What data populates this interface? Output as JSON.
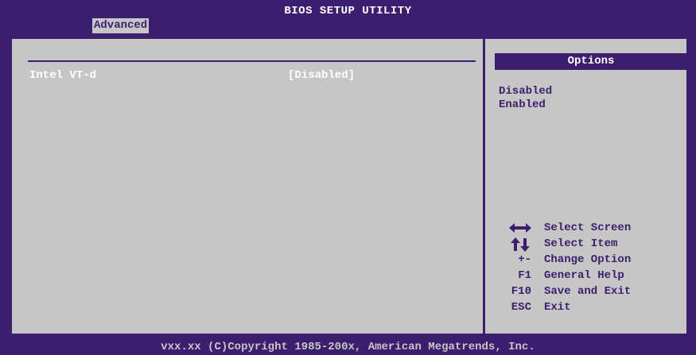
{
  "header": {
    "title": "BIOS SETUP UTILITY",
    "active_tab": "Advanced"
  },
  "settings": [
    {
      "label": "Intel VT-d",
      "value": "[Disabled]"
    }
  ],
  "options_panel": {
    "title": "Options",
    "items": [
      "Disabled",
      "Enabled"
    ]
  },
  "help": [
    {
      "key_icon": "left-right-arrows-icon",
      "key": "",
      "text": "Select Screen"
    },
    {
      "key_icon": "up-down-arrows-icon",
      "key": "",
      "text": "Select Item"
    },
    {
      "key": "+-",
      "text": "Change Option"
    },
    {
      "key": "F1",
      "text": "General Help"
    },
    {
      "key": "F10",
      "text": "Save and Exit"
    },
    {
      "key": "ESC",
      "text": "Exit"
    }
  ],
  "footer": {
    "copyright": "vxx.xx (C)Copyright 1985-200x, American Megatrends, Inc."
  },
  "colors": {
    "background": "#3b1e6e",
    "panel": "#c6c6c6",
    "highlight_text": "#ffffff"
  }
}
